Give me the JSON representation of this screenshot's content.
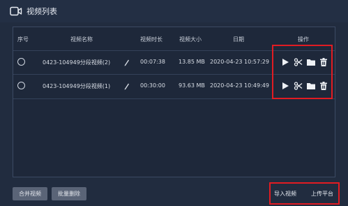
{
  "window": {
    "title": "视频列表"
  },
  "table": {
    "headers": {
      "index": "序号",
      "name": "视频名称",
      "duration": "视频时长",
      "size": "视频大小",
      "date": "日期",
      "actions": "操作"
    },
    "rows": [
      {
        "name": "0423-104949分段视频(2)",
        "duration": "00:07:38",
        "size": "13.85 MB",
        "date": "2020-04-23 10:57:29"
      },
      {
        "name": "0423-104949分段视频(1)",
        "duration": "00:30:00",
        "size": "93.63 MB",
        "date": "2020-04-23 10:49:49"
      }
    ],
    "row_action_icons": [
      "play-icon",
      "scissors-icon",
      "folder-icon",
      "trash-icon"
    ]
  },
  "footer": {
    "merge_label": "合并视频",
    "batch_delete_label": "批量删除",
    "import_label": "导入视频",
    "upload_label": "上传平台"
  },
  "colors": {
    "background": "#212c3f",
    "panel": "#1e283a",
    "highlight": "#e21c22",
    "button": "#5a6477"
  }
}
